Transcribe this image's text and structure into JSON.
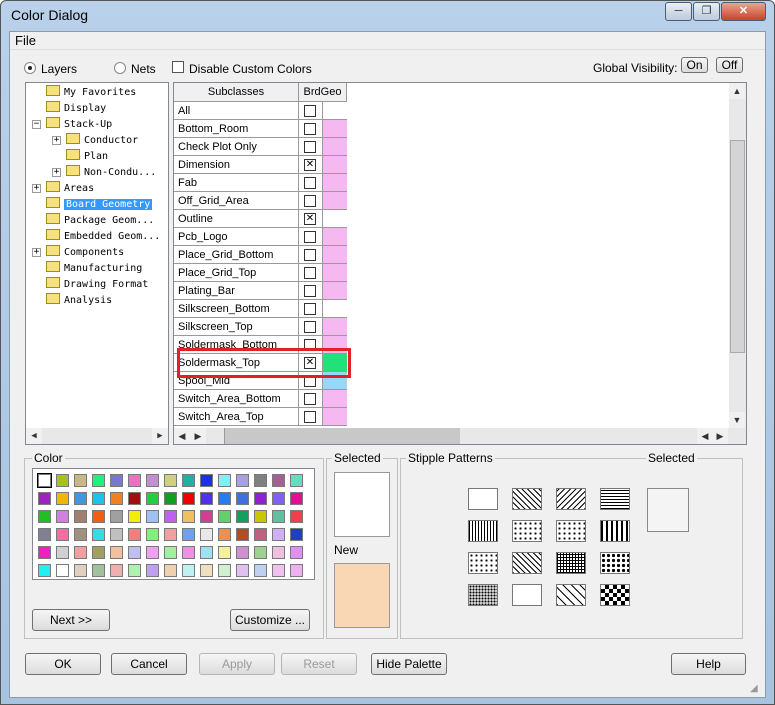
{
  "window": {
    "title": "Color Dialog",
    "controls": [
      "─",
      "❐",
      "✕"
    ]
  },
  "menu": {
    "file": "File"
  },
  "top": {
    "layers_label": "Layers",
    "nets_label": "Nets",
    "disable_custom_label": "Disable Custom Colors",
    "global_visibility_label": "Global Visibility:",
    "on_label": "On",
    "off_label": "Off"
  },
  "tree": [
    {
      "label": "My Favorites",
      "level": 0,
      "expander": ""
    },
    {
      "label": "Display",
      "level": 0,
      "expander": ""
    },
    {
      "label": "Stack-Up",
      "level": 0,
      "expander": "−"
    },
    {
      "label": "Conductor",
      "level": 1,
      "expander": "+"
    },
    {
      "label": "Plan",
      "level": 1,
      "expander": ""
    },
    {
      "label": "Non-Condu...",
      "level": 1,
      "expander": "+"
    },
    {
      "label": "Areas",
      "level": 0,
      "expander": "+"
    },
    {
      "label": "Board Geometry",
      "level": 0,
      "expander": "",
      "selected": true
    },
    {
      "label": "Package Geom...",
      "level": 0,
      "expander": ""
    },
    {
      "label": "Embedded Geom...",
      "level": 0,
      "expander": ""
    },
    {
      "label": "Components",
      "level": 0,
      "expander": "+"
    },
    {
      "label": "Manufacturing",
      "level": 0,
      "expander": ""
    },
    {
      "label": "Drawing Format",
      "level": 0,
      "expander": ""
    },
    {
      "label": "Analysis",
      "level": 0,
      "expander": ""
    }
  ],
  "grid": {
    "header_subclasses": "Subclasses",
    "header_brdgeo": "BrdGeo",
    "rows": [
      {
        "name": "All",
        "checked": false,
        "color": "#ffffff"
      },
      {
        "name": "Bottom_Room",
        "checked": false,
        "color": "#f5b8f0"
      },
      {
        "name": "Check Plot Only",
        "checked": false,
        "color": "#f5b8f0"
      },
      {
        "name": "Dimension",
        "checked": true,
        "color": "#f5b8f0"
      },
      {
        "name": "Fab",
        "checked": false,
        "color": "#f5b8f0"
      },
      {
        "name": "Off_Grid_Area",
        "checked": false,
        "color": "#f5b8f0"
      },
      {
        "name": "Outline",
        "checked": true,
        "color": "#ffffff"
      },
      {
        "name": "Pcb_Logo",
        "checked": false,
        "color": "#f5b8f0"
      },
      {
        "name": "Place_Grid_Bottom",
        "checked": false,
        "color": "#f5b8f0"
      },
      {
        "name": "Place_Grid_Top",
        "checked": false,
        "color": "#f5b8f0"
      },
      {
        "name": "Plating_Bar",
        "checked": false,
        "color": "#f5b8f0"
      },
      {
        "name": "Silkscreen_Bottom",
        "checked": false,
        "color": "#ffffff"
      },
      {
        "name": "Silkscreen_Top",
        "checked": false,
        "color": "#f5b8f0"
      },
      {
        "name": "Soldermask_Bottom",
        "checked": false,
        "color": "#f5b8f0"
      },
      {
        "name": "Soldermask_Top",
        "checked": true,
        "color": "#22e07a"
      },
      {
        "name": "Spool_Mid",
        "checked": false,
        "color": "#98d8f5"
      },
      {
        "name": "Switch_Area_Bottom",
        "checked": false,
        "color": "#f5b8f0"
      },
      {
        "name": "Switch_Area_Top",
        "checked": false,
        "color": "#f5b8f0"
      }
    ]
  },
  "color_group": {
    "label": "Color",
    "next_label": "Next >>",
    "customize_label": "Customize ...",
    "swatches": [
      [
        "#ffffff",
        "#a8c020",
        "#c8b888",
        "#20f080",
        "#7878d0",
        "#f070c0",
        "#c090d0",
        "#d0d080",
        "#20b0a0",
        "#2030e0",
        "#80f0f0",
        "#a8a0e0",
        "#808080",
        "#a06090",
        "#60e0c0"
      ],
      [
        "#a020c0",
        "#f0b800",
        "#4098e0",
        "#20c0f0",
        "#f08020",
        "#a01010",
        "#20d040",
        "#10a020",
        "#f00000",
        "#5030f0",
        "#2080f0",
        "#4070e0",
        "#9020d0",
        "#8060f0",
        "#e01090"
      ],
      [
        "#20c020",
        "#d080e0",
        "#a08070",
        "#f06010",
        "#a0a0a0",
        "#f0f000",
        "#a0c0f0",
        "#c060f0",
        "#f0c060",
        "#d04090",
        "#60d070",
        "#10a060",
        "#c8c800",
        "#60c0a0",
        "#f04050"
      ],
      [
        "#808090",
        "#f070a0",
        "#a09080",
        "#30e0e0",
        "#c0c0c0",
        "#f08080",
        "#80f080",
        "#f0a0a0",
        "#70a0f0",
        "#e8e8e8",
        "#f09050",
        "#b05020",
        "#c06080",
        "#d0b0f0",
        "#2040c0"
      ],
      [
        "#f020c0",
        "#d0d0d0",
        "#f0a0a0",
        "#a0a060",
        "#f0c0a0",
        "#c0c0f0",
        "#f0a0f0",
        "#a0f0a0",
        "#f090e0",
        "#a0e0f0",
        "#f0f0a0",
        "#d090d0",
        "#a0d090",
        "#f0c0e0",
        "#e090f0"
      ],
      [
        "#20f0f0",
        "#ffffff",
        "#e0d0c0",
        "#a0c0a0",
        "#f0b0b0",
        "#b0f0b0",
        "#c0a0f0",
        "#f0d0b0",
        "#c0f0f0",
        "#f0e0c0",
        "#d0f0d0",
        "#e0c0f0",
        "#c0d0f0",
        "#f0c0f0",
        "#f0b0f0"
      ]
    ]
  },
  "selected_group": {
    "selected_label": "Selected",
    "new_label": "New",
    "selected_color": "#ffffff",
    "new_color": "#f9d6b4"
  },
  "stipple_group": {
    "label": "Stipple Patterns",
    "selected_label": "Selected"
  },
  "buttons": {
    "ok": "OK",
    "cancel": "Cancel",
    "apply": "Apply",
    "reset": "Reset",
    "hide_palette": "Hide Palette",
    "help": "Help"
  }
}
